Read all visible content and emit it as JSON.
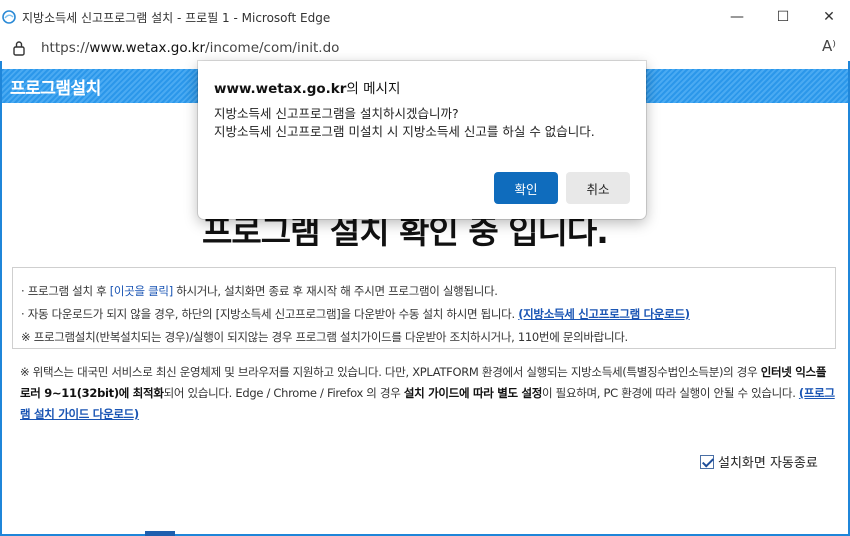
{
  "window": {
    "title": "지방소득세 신고프로그램 설치 - 프로필 1 - Microsoft Edge",
    "minimize_glyph": "—",
    "maximize_glyph": "☐",
    "close_glyph": "✕"
  },
  "address": {
    "url_prefix": "https://",
    "url_host": "www.wetax.go.kr",
    "url_path": "/income/com/init.do",
    "read_aloud_glyph": "A⁾"
  },
  "page": {
    "header_title": "프로그램설치",
    "big_text": "프로그램 설치 확인 중 입니다.",
    "info": {
      "line1_pre": "· 프로그램 설치 후 ",
      "line1_link": "[이곳을 클릭]",
      "line1_post": " 하시거나, 설치화면 종료 후 재시작 해 주시면 프로그램이 실행됩니다.",
      "line2_pre": "· 자동 다운로드가 되지 않을 경우, 하단의 [지방소득세 신고프로그램]을 다운받아 수동 설치 하시면 됩니다. ",
      "line2_link": "(지방소득세 신고프로그램 다운로드)",
      "line3": "※ 프로그램설치(반복설치되는 경우)/실행이 되지않는 경우 프로그램 설치가이드를 다운받아 조치하시거나, 110번에 문의바랍니다."
    },
    "notice": {
      "part1": "※ 위택스는 대국민 서비스로 최신 운영체제 및 브라우저를 지원하고 있습니다. 다만, XPLATFORM 환경에서 실행되는 지방소득세(특별징수법인소득분)의 경우 ",
      "bold1": "인터넷 익스플로러 9~11(32bit)에 최적화",
      "part2": "되어 있습니다. Edge / Chrome / Firefox 의 경우 ",
      "bold2": "설치 가이드에 따라 별도 설정",
      "part3": "이 필요하며, PC 환경에 따라 실행이 안될 수 있습니다. ",
      "link": "(프로그램 설치 가이드 다운로드)"
    },
    "autoclose_label": "설치화면 자동종료",
    "autoclose_checked": true
  },
  "dialog": {
    "title_host": "www.wetax.go.kr",
    "title_suffix": "의 메시지",
    "line1": "지방소득세 신고프로그램을 설치하시겠습니까?",
    "line2": "지방소득세 신고프로그램 미설치 시 지방소득세 신고를 하실 수 없습니다.",
    "ok_label": "확인",
    "cancel_label": "취소"
  },
  "colors": {
    "header_blue": "#2b97ea",
    "link_blue": "#1a55b4",
    "primary_button": "#0f6cbd"
  }
}
